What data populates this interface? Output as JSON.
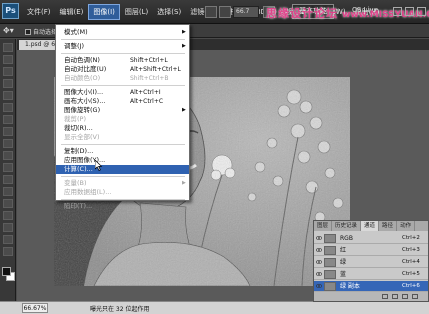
{
  "colors": {
    "accent": "#2f62b1",
    "watermark": "#e0428a",
    "menu_bg": "#ffffff",
    "menubar_bg": "#2e2e2e"
  },
  "app": {
    "logo": "Ps",
    "menus": [
      {
        "label": "文件(F)"
      },
      {
        "label": "编辑(E)"
      },
      {
        "label": "图像(I)",
        "active": true
      },
      {
        "label": "图层(L)"
      },
      {
        "label": "选择(S)"
      },
      {
        "label": "滤镜(T)"
      },
      {
        "label": "分析(A)"
      },
      {
        "label": "3D(D)"
      },
      {
        "label": "视图(V)"
      },
      {
        "label": "窗口(W)"
      },
      {
        "label": "帮助(H)"
      }
    ],
    "zoom_select": "66.7",
    "workspace_button": "基本功能",
    "cs_live": "CS Live"
  },
  "watermark": {
    "cn": "思缘设计论坛",
    "url": "www.MISSYUAN.COM"
  },
  "options_bar": {
    "auto_select_label": "自动选择"
  },
  "document": {
    "tab_label": "1.psd @ 66.7%"
  },
  "image_menu": {
    "items": [
      {
        "label": "模式(M)",
        "shortcut": "",
        "submenu": true,
        "disabled": false
      },
      {
        "type": "separator"
      },
      {
        "label": "调整(J)",
        "shortcut": "",
        "submenu": true,
        "disabled": false
      },
      {
        "type": "separator"
      },
      {
        "label": "自动色调(N)",
        "shortcut": "Shift+Ctrl+L",
        "disabled": false
      },
      {
        "label": "自动对比度(U)",
        "shortcut": "Alt+Shift+Ctrl+L",
        "disabled": false
      },
      {
        "label": "自动颜色(O)",
        "shortcut": "Shift+Ctrl+B",
        "disabled": true
      },
      {
        "type": "separator"
      },
      {
        "label": "图像大小(I)...",
        "shortcut": "Alt+Ctrl+I",
        "disabled": false
      },
      {
        "label": "画布大小(S)...",
        "shortcut": "Alt+Ctrl+C",
        "disabled": false
      },
      {
        "label": "图像旋转(G)",
        "shortcut": "",
        "submenu": true,
        "disabled": false
      },
      {
        "label": "裁剪(P)",
        "shortcut": "",
        "disabled": true
      },
      {
        "label": "裁切(R)...",
        "shortcut": "",
        "disabled": false
      },
      {
        "label": "显示全部(V)",
        "shortcut": "",
        "disabled": true
      },
      {
        "type": "separator"
      },
      {
        "label": "复制(D)...",
        "shortcut": "",
        "disabled": false
      },
      {
        "label": "应用图像(Y)...",
        "shortcut": "",
        "disabled": false
      },
      {
        "label": "计算(C)...",
        "shortcut": "",
        "disabled": false,
        "highlight": true
      },
      {
        "type": "separator"
      },
      {
        "label": "变量(B)",
        "shortcut": "",
        "submenu": true,
        "disabled": true
      },
      {
        "label": "应用数据组(L)...",
        "shortcut": "",
        "disabled": true
      },
      {
        "type": "separator"
      },
      {
        "label": "陷印(T)...",
        "shortcut": "",
        "disabled": true
      }
    ]
  },
  "channels_panel": {
    "tabs": [
      {
        "label": "图层"
      },
      {
        "label": "历史记录"
      },
      {
        "label": "通道",
        "active": true
      },
      {
        "label": "路径"
      },
      {
        "label": "动作"
      }
    ],
    "rows": [
      {
        "name": "RGB",
        "shortcut": "Ctrl+2"
      },
      {
        "name": "红",
        "shortcut": "Ctrl+3"
      },
      {
        "name": "绿",
        "shortcut": "Ctrl+4"
      },
      {
        "name": "蓝",
        "shortcut": "Ctrl+5"
      },
      {
        "name": "绿 副本",
        "shortcut": "Ctrl+6",
        "selected": true
      }
    ]
  },
  "status_bar": {
    "zoom": "66.67%",
    "info": "曝光只在 32 位起作用"
  }
}
